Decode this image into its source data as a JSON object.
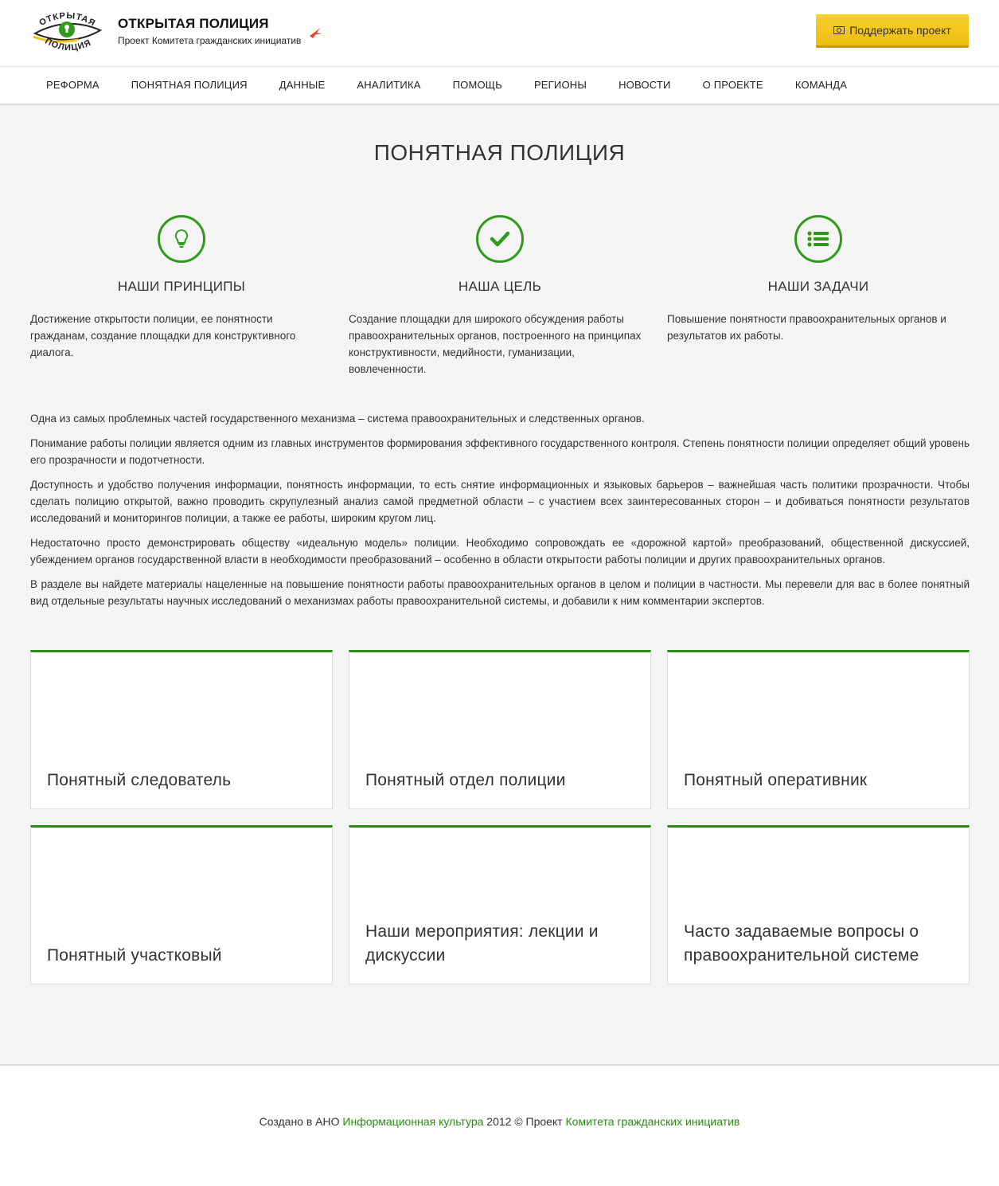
{
  "header": {
    "logo_text_top": "ОТКРЫТАЯ",
    "logo_text_bottom": "ПОЛИЦИЯ",
    "title": "ОТКРЫТАЯ ПОЛИЦИЯ",
    "subtitle": "Проект Комитета гражданских инициатив",
    "support_label": "Поддержать проект"
  },
  "nav": {
    "items": [
      "РЕФОРМА",
      "ПОНЯТНАЯ ПОЛИЦИЯ",
      "ДАННЫЕ",
      "АНАЛИТИКА",
      "ПОМОЩЬ",
      "РЕГИОНЫ",
      "НОВОСТИ",
      "О ПРОЕКТЕ",
      "КОМАНДА"
    ]
  },
  "main": {
    "title": "ПОНЯТНАЯ ПОЛИЦИЯ",
    "features": [
      {
        "icon": "lightbulb-icon",
        "heading": "НАШИ ПРИНЦИПЫ",
        "text": "Достижение открытости полиции, ее понятности гражданам, создание площадки для конструктивного диалога."
      },
      {
        "icon": "check-icon",
        "heading": "НАША ЦЕЛЬ",
        "text": "Создание площадки для широкого обсуждения работы правоохранительных органов, построенного на принципах конструктивности, медийности, гуманизации, вовлеченности."
      },
      {
        "icon": "list-icon",
        "heading": "НАШИ ЗАДАЧИ",
        "text": "Повышение понятности правоохранительных органов и результатов их работы."
      }
    ],
    "paragraphs": [
      "Одна из самых проблемных частей государственного механизма – система правоохранительных и следственных органов.",
      "Понимание работы полиции является одним из главных инструментов формирования эффективного государственного контроля. Степень понятности полиции определяет общий уровень его прозрачности и подотчетности.",
      "Доступность и удобство получения информации, понятность информации, то есть снятие информационных и языковых барьеров – важнейшая часть политики прозрачности. Чтобы сделать полицию открытой, важно проводить скрупулезный анализ самой предметной области – с участием всех заинтересованных сторон – и добиваться понятности результатов исследований и мониторингов полиции,  а также ее работы, широким кругом лиц.",
      "Недостаточно просто демонстрировать обществу «идеальную модель» полиции. Необходимо сопровождать ее «дорожной картой» преобразований, общественной дискуссией, убеждением органов государственной власти в необходимости преобразований – особенно в области открытости работы полиции и других правоохранительных органов.",
      "В разделе вы найдете материалы нацеленные на повышение понятности работы правоохранительных органов в целом и полиции в частности. Мы перевели для вас в более понятный вид отдельные результаты научных исследований о механизмах работы правоохранительной системы, и добавили к ним комментарии экспертов."
    ],
    "cards": [
      "Понятный следователь",
      "Понятный отдел полиции",
      "Понятный оперативник",
      "Понятный участковый",
      "Наши мероприятия: лекции и дискуссии",
      "Часто задаваемые вопросы о правоохранительной системе"
    ]
  },
  "footer": {
    "prefix": "Создано в АНО ",
    "link1": "Информационная культура",
    "middle": " 2012 © Проект ",
    "link2": "Комитета гражданских инициатив"
  },
  "colors": {
    "accent_green": "#2f9a1c",
    "button_yellow": "#f2c41e"
  }
}
